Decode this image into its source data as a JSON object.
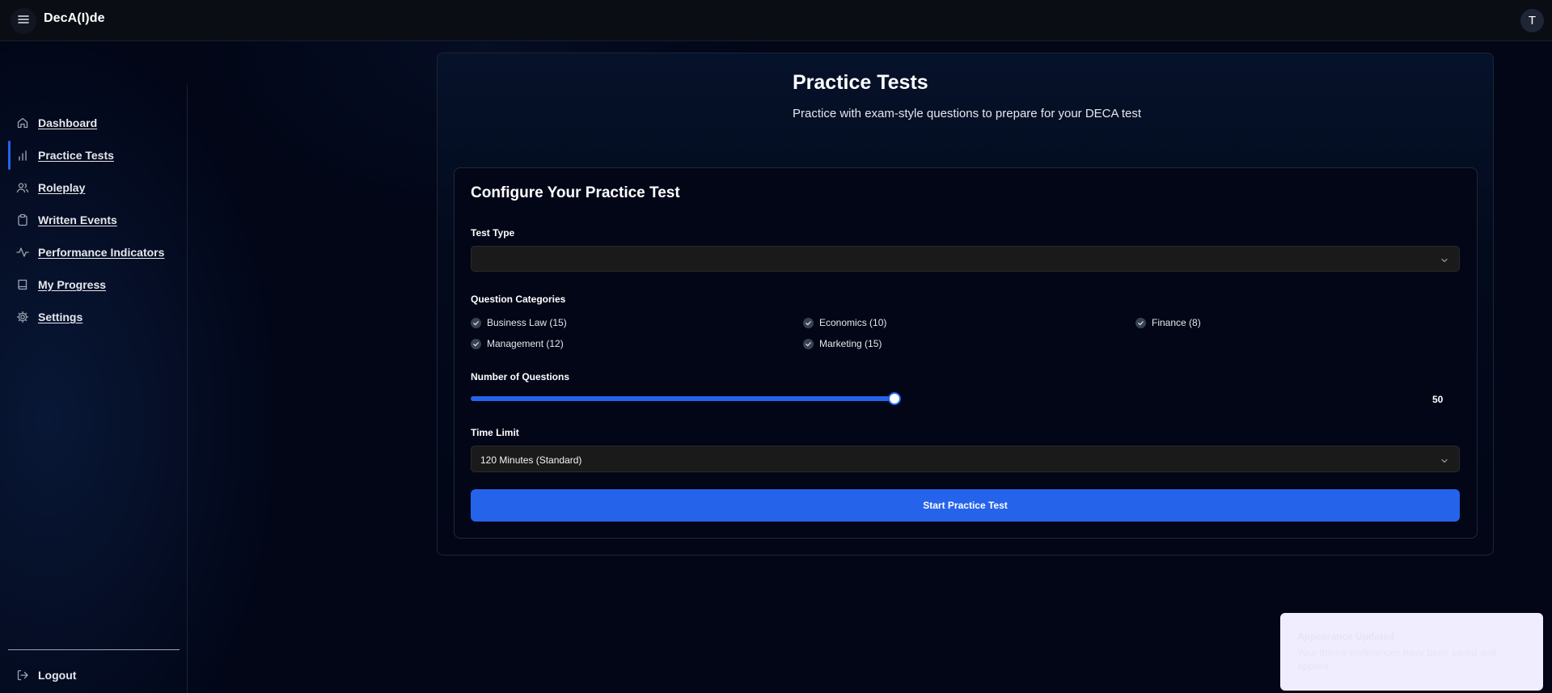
{
  "app": {
    "brand": "DecA(I)de",
    "user_initial": "T"
  },
  "sidebar": {
    "items": [
      {
        "label": "Dashboard",
        "icon": "home-icon",
        "active": false
      },
      {
        "label": "Practice Tests",
        "icon": "bar-chart-icon",
        "active": true
      },
      {
        "label": "Roleplay",
        "icon": "users-icon",
        "active": false
      },
      {
        "label": "Written Events",
        "icon": "clipboard-icon",
        "active": false
      },
      {
        "label": "Performance Indicators",
        "icon": "activity-icon",
        "active": false
      },
      {
        "label": "My Progress",
        "icon": "book-icon",
        "active": false
      },
      {
        "label": "Settings",
        "icon": "gear-icon",
        "active": false
      }
    ],
    "logout_label": "Logout"
  },
  "main": {
    "title": "Practice Tests",
    "subtitle": "Practice with exam-style questions to prepare for your DECA test",
    "configure": {
      "title": "Configure Your Practice Test",
      "test_type_label": "Test Type",
      "test_type_value": "",
      "categories_label": "Question Categories",
      "categories": [
        {
          "label": "Business Law (15)",
          "checked": true
        },
        {
          "label": "Economics (10)",
          "checked": true
        },
        {
          "label": "Finance (8)",
          "checked": true
        },
        {
          "label": "Management (12)",
          "checked": true
        },
        {
          "label": "Marketing (15)",
          "checked": true
        }
      ],
      "num_questions_label": "Number of Questions",
      "num_questions_value": "50",
      "time_limit_label": "Time Limit",
      "time_limit_value": "120 Minutes (Standard)",
      "start_button": "Start Practice Test"
    }
  },
  "toast": {
    "title": "Appearance Updated",
    "body": "Your theme preferences have been saved and applied."
  },
  "colors": {
    "accent": "#2563eb",
    "background": "#020617",
    "toast_bg": "#f0eefe"
  }
}
